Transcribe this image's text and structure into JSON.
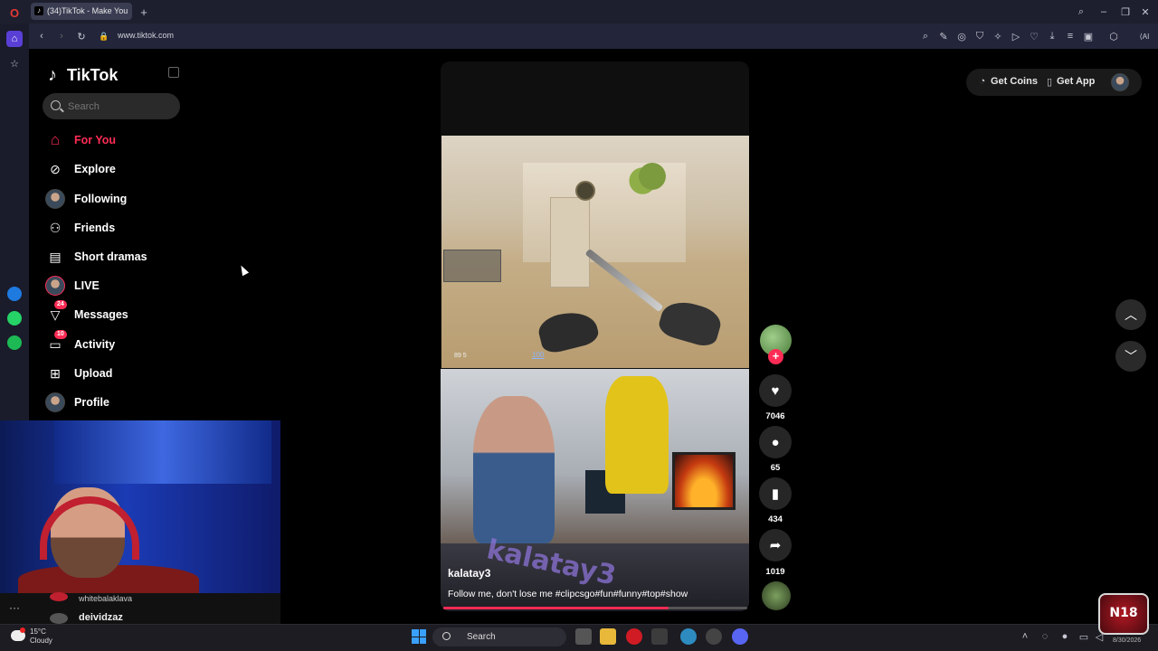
{
  "browser": {
    "tab_title": "(34)TikTok - Make You",
    "url": "www.tiktok.com"
  },
  "tiktok": {
    "logo": "TikTok",
    "search_placeholder": "Search",
    "nav": [
      {
        "label": "For You",
        "icon": "home-icon",
        "active": true
      },
      {
        "label": "Explore",
        "icon": "compass-icon"
      },
      {
        "label": "Following",
        "icon": "avatar-icon"
      },
      {
        "label": "Friends",
        "icon": "friends-icon"
      },
      {
        "label": "Short dramas",
        "icon": "film-icon"
      },
      {
        "label": "LIVE",
        "icon": "live-avatar-icon"
      },
      {
        "label": "Messages",
        "icon": "messages-icon",
        "badge": "24"
      },
      {
        "label": "Activity",
        "icon": "activity-icon",
        "badge": "10"
      },
      {
        "label": "Upload",
        "icon": "upload-icon"
      },
      {
        "label": "Profile",
        "icon": "profile-avatar-icon"
      }
    ],
    "top": {
      "get_coins": "Get Coins",
      "get_app": "Get App"
    },
    "video": {
      "username": "kalatay3",
      "caption": "Follow me, don't lose me #clipcsgo#fun#funny#top#show",
      "hud_left": "89 5",
      "hud_ammo": "100",
      "progress": 0.74
    },
    "actions": {
      "likes": "7046",
      "comments": "65",
      "saves": "434",
      "shares": "1019"
    }
  },
  "stream_overlay": {
    "chat": [
      {
        "user": "whitebalaklava"
      },
      {
        "user": "deividzaz"
      }
    ]
  },
  "taskbar": {
    "weather_temp": "15°C",
    "weather_desc": "Cloudy",
    "search_label": "Search",
    "date": "8/30/2026"
  },
  "colors": {
    "accent": "#fe2c55",
    "browser_bg": "#1d1f2e"
  }
}
